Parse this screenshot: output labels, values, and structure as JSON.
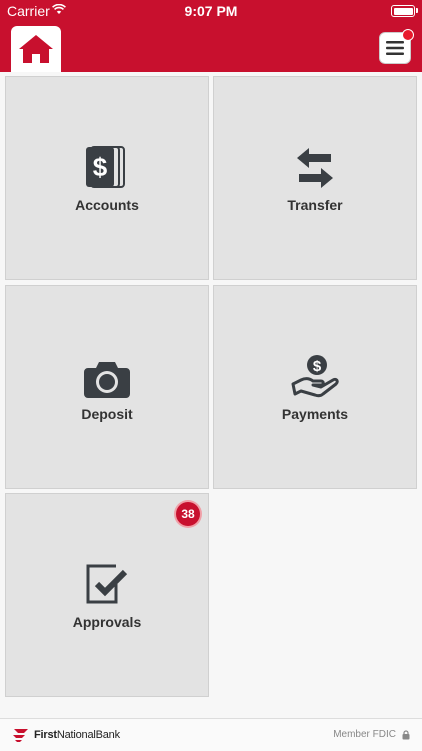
{
  "status_bar": {
    "carrier": "Carrier",
    "time": "9:07 PM"
  },
  "header": {
    "home_icon": "home-icon",
    "menu_icon": "hamburger-menu-icon"
  },
  "tiles": [
    {
      "label": "Accounts",
      "icon": "dollar-documents-icon"
    },
    {
      "label": "Transfer",
      "icon": "transfer-arrows-icon"
    },
    {
      "label": "Deposit",
      "icon": "camera-icon"
    },
    {
      "label": "Payments",
      "icon": "hand-coin-icon"
    },
    {
      "label": "Approvals",
      "icon": "checkbox-icon",
      "badge": "38"
    }
  ],
  "footer": {
    "brand_bold": "First",
    "brand_light": "NationalBank",
    "fdic": "Member FDIC"
  },
  "colors": {
    "brand_red": "#c8102e",
    "tile_bg": "#e3e3e3",
    "icon_dark": "#3a3f44"
  }
}
